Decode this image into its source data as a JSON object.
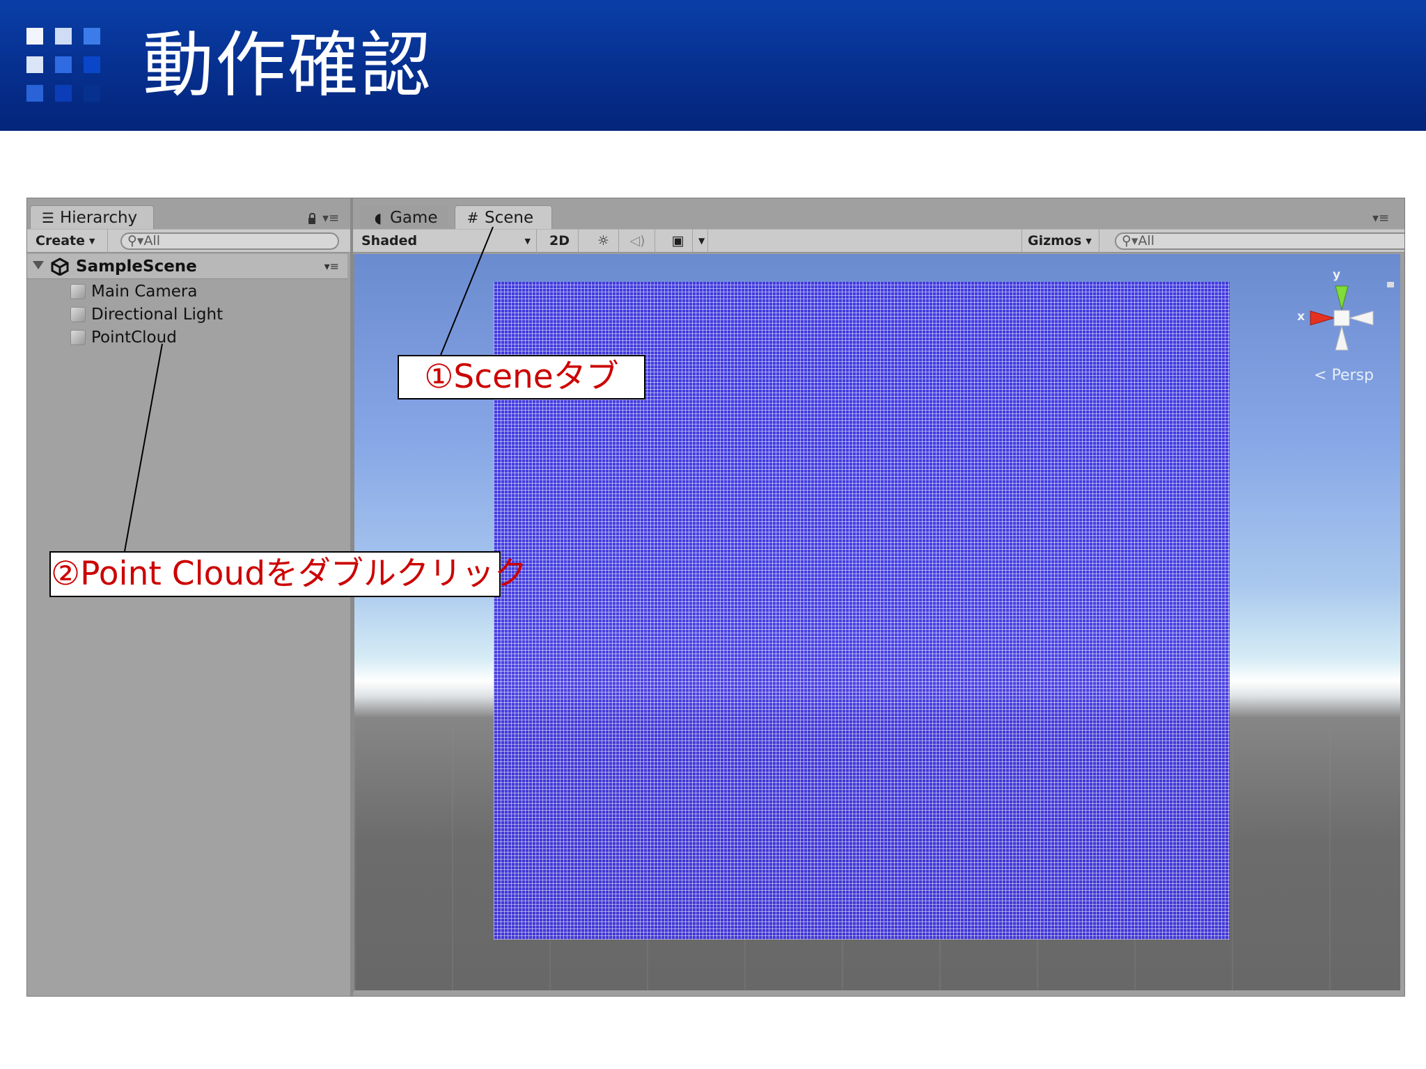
{
  "slide": {
    "title": "動作確認",
    "brand_color": "#0a3fa8"
  },
  "hierarchy": {
    "tab_label": "Hierarchy",
    "create_label": "Create",
    "search_placeholder": "All",
    "scene_name": "SampleScene",
    "items": [
      {
        "label": "Main Camera",
        "icon": "gameobject-cube-icon"
      },
      {
        "label": "Directional Light",
        "icon": "gameobject-cube-icon"
      },
      {
        "label": "PointCloud",
        "icon": "gameobject-cube-icon"
      }
    ]
  },
  "scene_view": {
    "tabs": [
      {
        "label": "Game",
        "icon": "game-controller-icon",
        "active": false
      },
      {
        "label": "Scene",
        "icon": "hash-grid-icon",
        "active": true
      }
    ],
    "shading_mode": "Shaded",
    "toggle_2d": "2D",
    "gizmos_label": "Gizmos",
    "search_placeholder": "All",
    "projection_label": "Persp",
    "axis_x": "x",
    "axis_y": "y",
    "point_cloud_color": "#3e34e0"
  },
  "annotations": {
    "scene_tab": "①Sceneタブ",
    "point_cloud": "②Point Cloudをダブルクリック",
    "color": "#cc0000"
  }
}
